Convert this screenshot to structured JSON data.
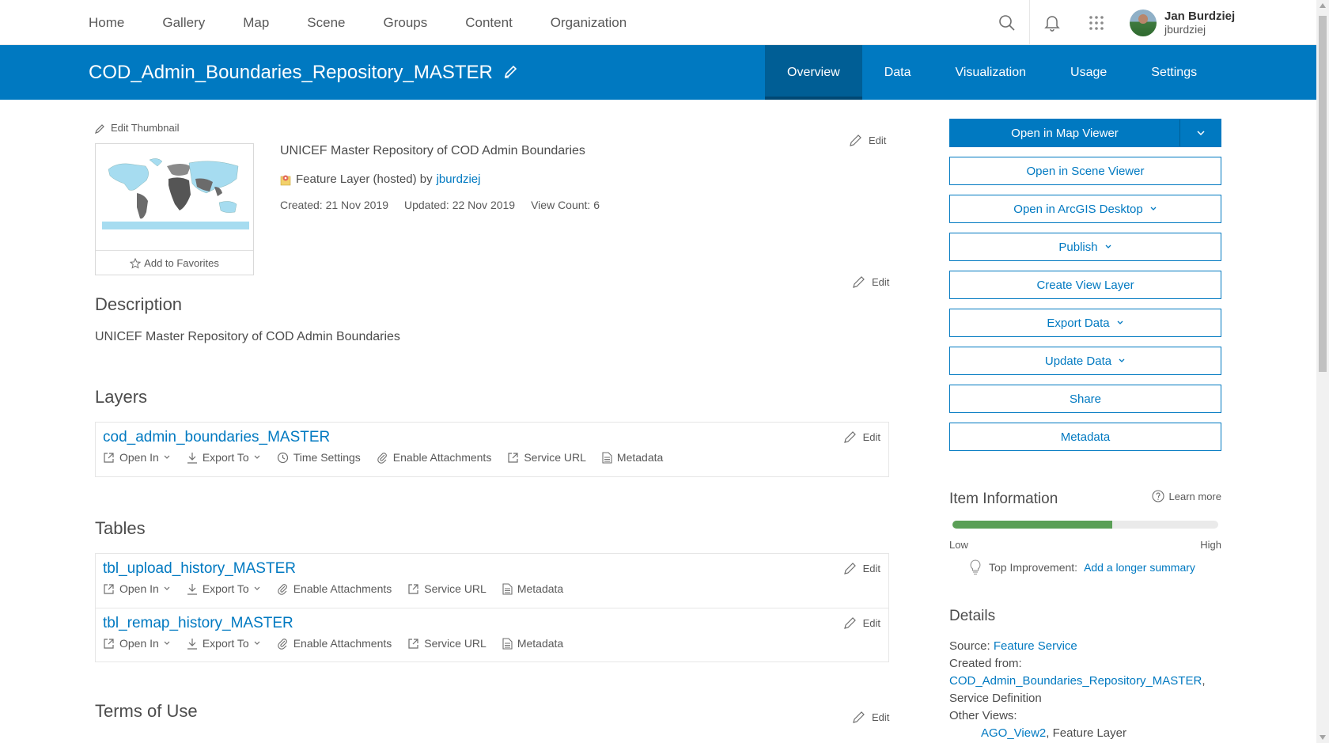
{
  "nav": {
    "links": [
      "Home",
      "Gallery",
      "Map",
      "Scene",
      "Groups",
      "Content",
      "Organization"
    ],
    "user_name": "Jan Burdziej",
    "user_id": "jburdziej"
  },
  "banner": {
    "title": "COD_Admin_Boundaries_Repository_MASTER",
    "tabs": [
      "Overview",
      "Data",
      "Visualization",
      "Usage",
      "Settings"
    ],
    "active_tab": "Overview"
  },
  "overview": {
    "edit_thumbnail": "Edit Thumbnail",
    "add_to_favorites": "Add to Favorites",
    "summary": "UNICEF Master Repository of COD Admin Boundaries",
    "item_type": "Feature Layer (hosted) by",
    "owner": "jburdziej",
    "created": "Created: 21 Nov 2019",
    "updated": "Updated: 22 Nov 2019",
    "view_count": "View Count: 6",
    "edit_label": "Edit"
  },
  "description": {
    "heading": "Description",
    "text": "UNICEF Master Repository of COD Admin Boundaries"
  },
  "layers": {
    "heading": "Layers",
    "items": [
      {
        "title": "cod_admin_boundaries_MASTER",
        "open_in": "Open In",
        "export_to": "Export To",
        "time_settings": "Time Settings",
        "enable_attachments": "Enable Attachments",
        "service_url": "Service URL",
        "metadata": "Metadata"
      }
    ]
  },
  "tables": {
    "heading": "Tables",
    "items": [
      {
        "title": "tbl_upload_history_MASTER",
        "open_in": "Open In",
        "export_to": "Export To",
        "enable_attachments": "Enable Attachments",
        "service_url": "Service URL",
        "metadata": "Metadata"
      },
      {
        "title": "tbl_remap_history_MASTER",
        "open_in": "Open In",
        "export_to": "Export To",
        "enable_attachments": "Enable Attachments",
        "service_url": "Service URL",
        "metadata": "Metadata"
      }
    ]
  },
  "terms": {
    "heading": "Terms of Use"
  },
  "sidebar": {
    "buttons": {
      "open_map_viewer": "Open in Map Viewer",
      "open_scene_viewer": "Open in Scene Viewer",
      "open_arcgis_desktop": "Open in ArcGIS Desktop",
      "publish": "Publish",
      "create_view_layer": "Create View Layer",
      "export_data": "Export Data",
      "update_data": "Update Data",
      "share": "Share",
      "metadata": "Metadata"
    },
    "item_information": {
      "heading": "Item Information",
      "learn_more": "Learn more",
      "quality_fraction": 0.6,
      "low": "Low",
      "high": "High",
      "top_improvement_label": "Top Improvement:",
      "top_improvement_link": "Add a longer summary"
    },
    "details": {
      "heading": "Details",
      "source_label": "Source:",
      "source_value": "Feature Service",
      "created_from_label": "Created from:",
      "created_from_link": "COD_Admin_Boundaries_Repository_MASTER",
      "created_from_suffix": ",",
      "service_definition": "Service Definition",
      "other_views_label": "Other Views:",
      "other_view_link": "AGO_View2",
      "other_view_suffix": ", Feature Layer"
    }
  },
  "colors": {
    "accent": "#0079c1",
    "banner_active": "#005e95",
    "quality_fill": "#5a9f56"
  }
}
